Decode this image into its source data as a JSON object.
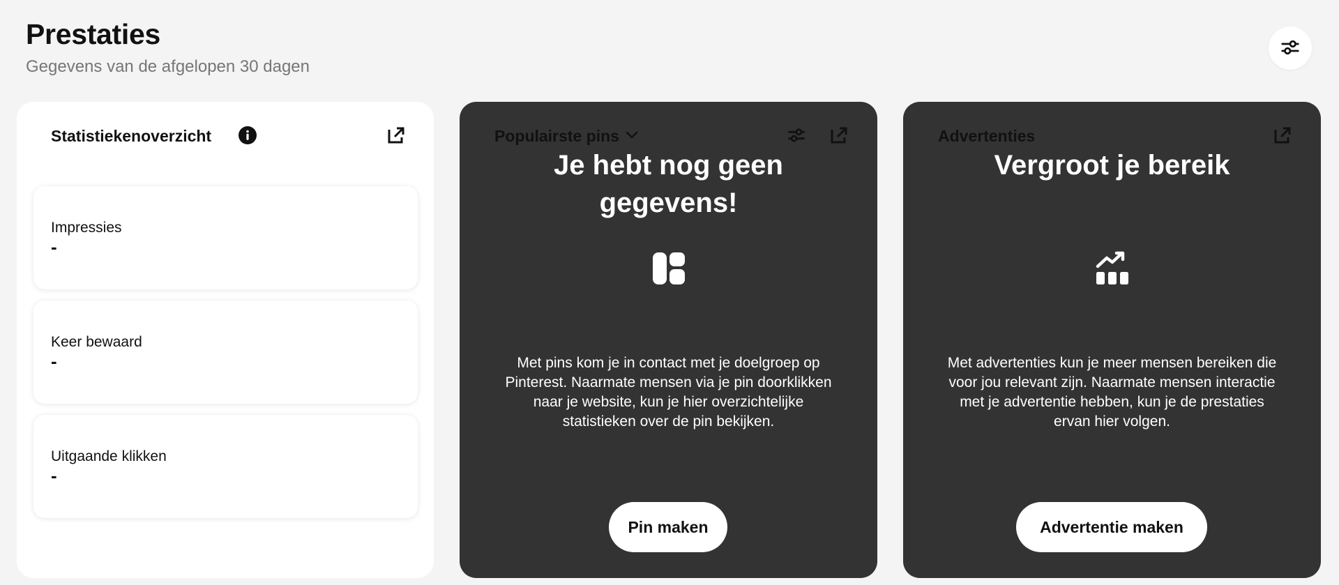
{
  "header": {
    "title": "Prestaties",
    "subtitle": "Gegevens van de afgelopen 30 dagen"
  },
  "overview": {
    "title": "Statistiekenoverzicht",
    "stats": [
      {
        "label": "Impressies",
        "value": "-"
      },
      {
        "label": "Keer bewaard",
        "value": "-"
      },
      {
        "label": "Uitgaande klikken",
        "value": "-"
      }
    ]
  },
  "pins": {
    "title": "Populairste pins",
    "headline": "Je hebt nog geen gegevens!",
    "body": "Met pins kom je in contact met je doelgroep op Pinterest. Naarmate mensen via je pin doorklikken naar je website, kun je hier overzichtelijke statistieken over de pin bekijken.",
    "button": "Pin maken"
  },
  "ads": {
    "title": "Advertenties",
    "headline": "Vergroot je bereik",
    "body": "Met advertenties kun je meer mensen bereiken die voor jou relevant zijn. Naarmate mensen interactie met je advertentie hebben, kun je de prestaties ervan hier volgen.",
    "button": "Advertentie maken"
  },
  "icons": {
    "filter": "filter-sliders-icon",
    "info": "info-icon",
    "open": "open-external-icon",
    "dropdown": "chevron-down-icon",
    "pins_illustration": "pin-layout-icon",
    "ads_illustration": "growth-chart-icon"
  },
  "colors": {
    "background": "#f4f4f4",
    "card_dark": "#333333",
    "card_light": "#ffffff",
    "text_primary": "#111111",
    "text_secondary": "#767676"
  }
}
